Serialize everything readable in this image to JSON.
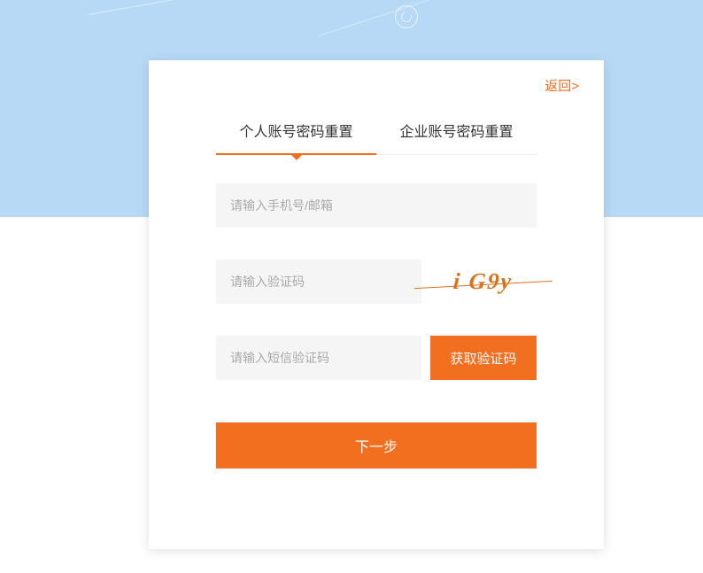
{
  "header": {
    "back_label": "返回>"
  },
  "tabs": {
    "personal": "个人账号密码重置",
    "enterprise": "企业账号密码重置"
  },
  "form": {
    "account_placeholder": "请输入手机号/邮箱",
    "captcha_placeholder": "请输入验证码",
    "captcha_image_text": "i G9y",
    "sms_placeholder": "请输入短信验证码",
    "sms_button_label": "获取验证码",
    "submit_label": "下一步"
  },
  "colors": {
    "accent": "#f36f20",
    "bg_top": "#b7d9f5",
    "input_bg": "#f5f5f5"
  }
}
